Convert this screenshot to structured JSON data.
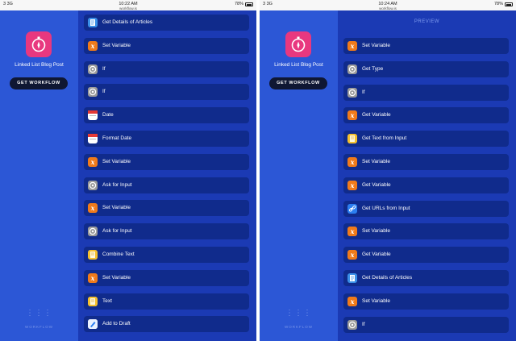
{
  "status_bar": {
    "carrier": "3  3G",
    "time": "10:22 AM",
    "time_right": "10:24 AM",
    "battery": "78%",
    "url": "workflow.is"
  },
  "sidebar": {
    "title": "Linked List Blog Post",
    "get_button": "GET WORKFLOW",
    "logo_text": "WORKFLOW"
  },
  "preview_label": "PREVIEW",
  "left_actions": [
    {
      "label": "Get Details of Articles",
      "icon": "doc-icon"
    },
    {
      "label": "Set Variable",
      "icon": "variable-icon"
    },
    {
      "label": "If",
      "icon": "gear-icon"
    },
    {
      "label": "If",
      "icon": "gear-icon"
    },
    {
      "label": "Date",
      "icon": "calendar-icon"
    },
    {
      "label": "Format Date",
      "icon": "calendar-icon"
    },
    {
      "label": "Set Variable",
      "icon": "variable-icon"
    },
    {
      "label": "Ask for Input",
      "icon": "gear-icon"
    },
    {
      "label": "Set Variable",
      "icon": "variable-icon"
    },
    {
      "label": "Ask for Input",
      "icon": "gear-icon"
    },
    {
      "label": "Combine Text",
      "icon": "text-icon"
    },
    {
      "label": "Set Variable",
      "icon": "variable-icon"
    },
    {
      "label": "Text",
      "icon": "text-icon"
    },
    {
      "label": "Add to Draft",
      "icon": "drafts-icon"
    }
  ],
  "right_actions": [
    {
      "label": "Set Variable",
      "icon": "variable-icon"
    },
    {
      "label": "Get Type",
      "icon": "gear-icon"
    },
    {
      "label": "If",
      "icon": "gear-icon"
    },
    {
      "label": "Get Variable",
      "icon": "variable-icon"
    },
    {
      "label": "Get Text from Input",
      "icon": "text-icon"
    },
    {
      "label": "Set Variable",
      "icon": "variable-icon"
    },
    {
      "label": "Get Variable",
      "icon": "variable-icon"
    },
    {
      "label": "Get URLs from Input",
      "icon": "link-icon"
    },
    {
      "label": "Set Variable",
      "icon": "variable-icon"
    },
    {
      "label": "Get Variable",
      "icon": "variable-icon"
    },
    {
      "label": "Get Details of Articles",
      "icon": "doc-icon"
    },
    {
      "label": "Set Variable",
      "icon": "variable-icon"
    },
    {
      "label": "If",
      "icon": "gear-icon"
    }
  ],
  "colors": {
    "background": "#1b3ab4",
    "sidebar": "#2c57d6",
    "action_row": "#102b8c",
    "app_icon": "#e8387f",
    "variable": "#f07a1a",
    "gear": "#9b9b9b",
    "text": "#f5c12f",
    "link": "#2b7ef0"
  }
}
